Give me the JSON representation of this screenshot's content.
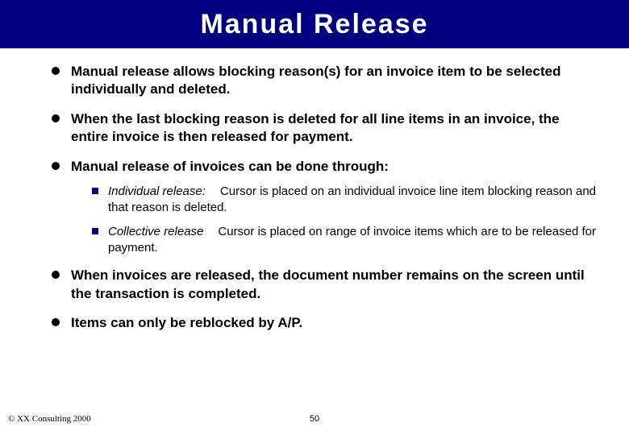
{
  "title": "Manual Release",
  "bullets": [
    {
      "text": "Manual release allows blocking reason(s) for an invoice item to be selected individually and deleted."
    },
    {
      "text": "When the last blocking reason is deleted for all line items in an invoice, the entire invoice is then released for payment."
    },
    {
      "text": "Manual release of invoices can be done through:",
      "sub": [
        {
          "label": "Individual release:",
          "desc": "Cursor is placed on an individual invoice line item blocking reason and that reason is deleted."
        },
        {
          "label": "Collective release",
          "desc": "Cursor is placed on range of invoice items which are to be released for payment."
        }
      ]
    },
    {
      "text": "When invoices are released, the document number remains on the screen until the transaction is completed."
    },
    {
      "text": "Items can only be reblocked by A/P."
    }
  ],
  "footer": {
    "copyright": "© XX Consulting 2000",
    "page": "50"
  }
}
